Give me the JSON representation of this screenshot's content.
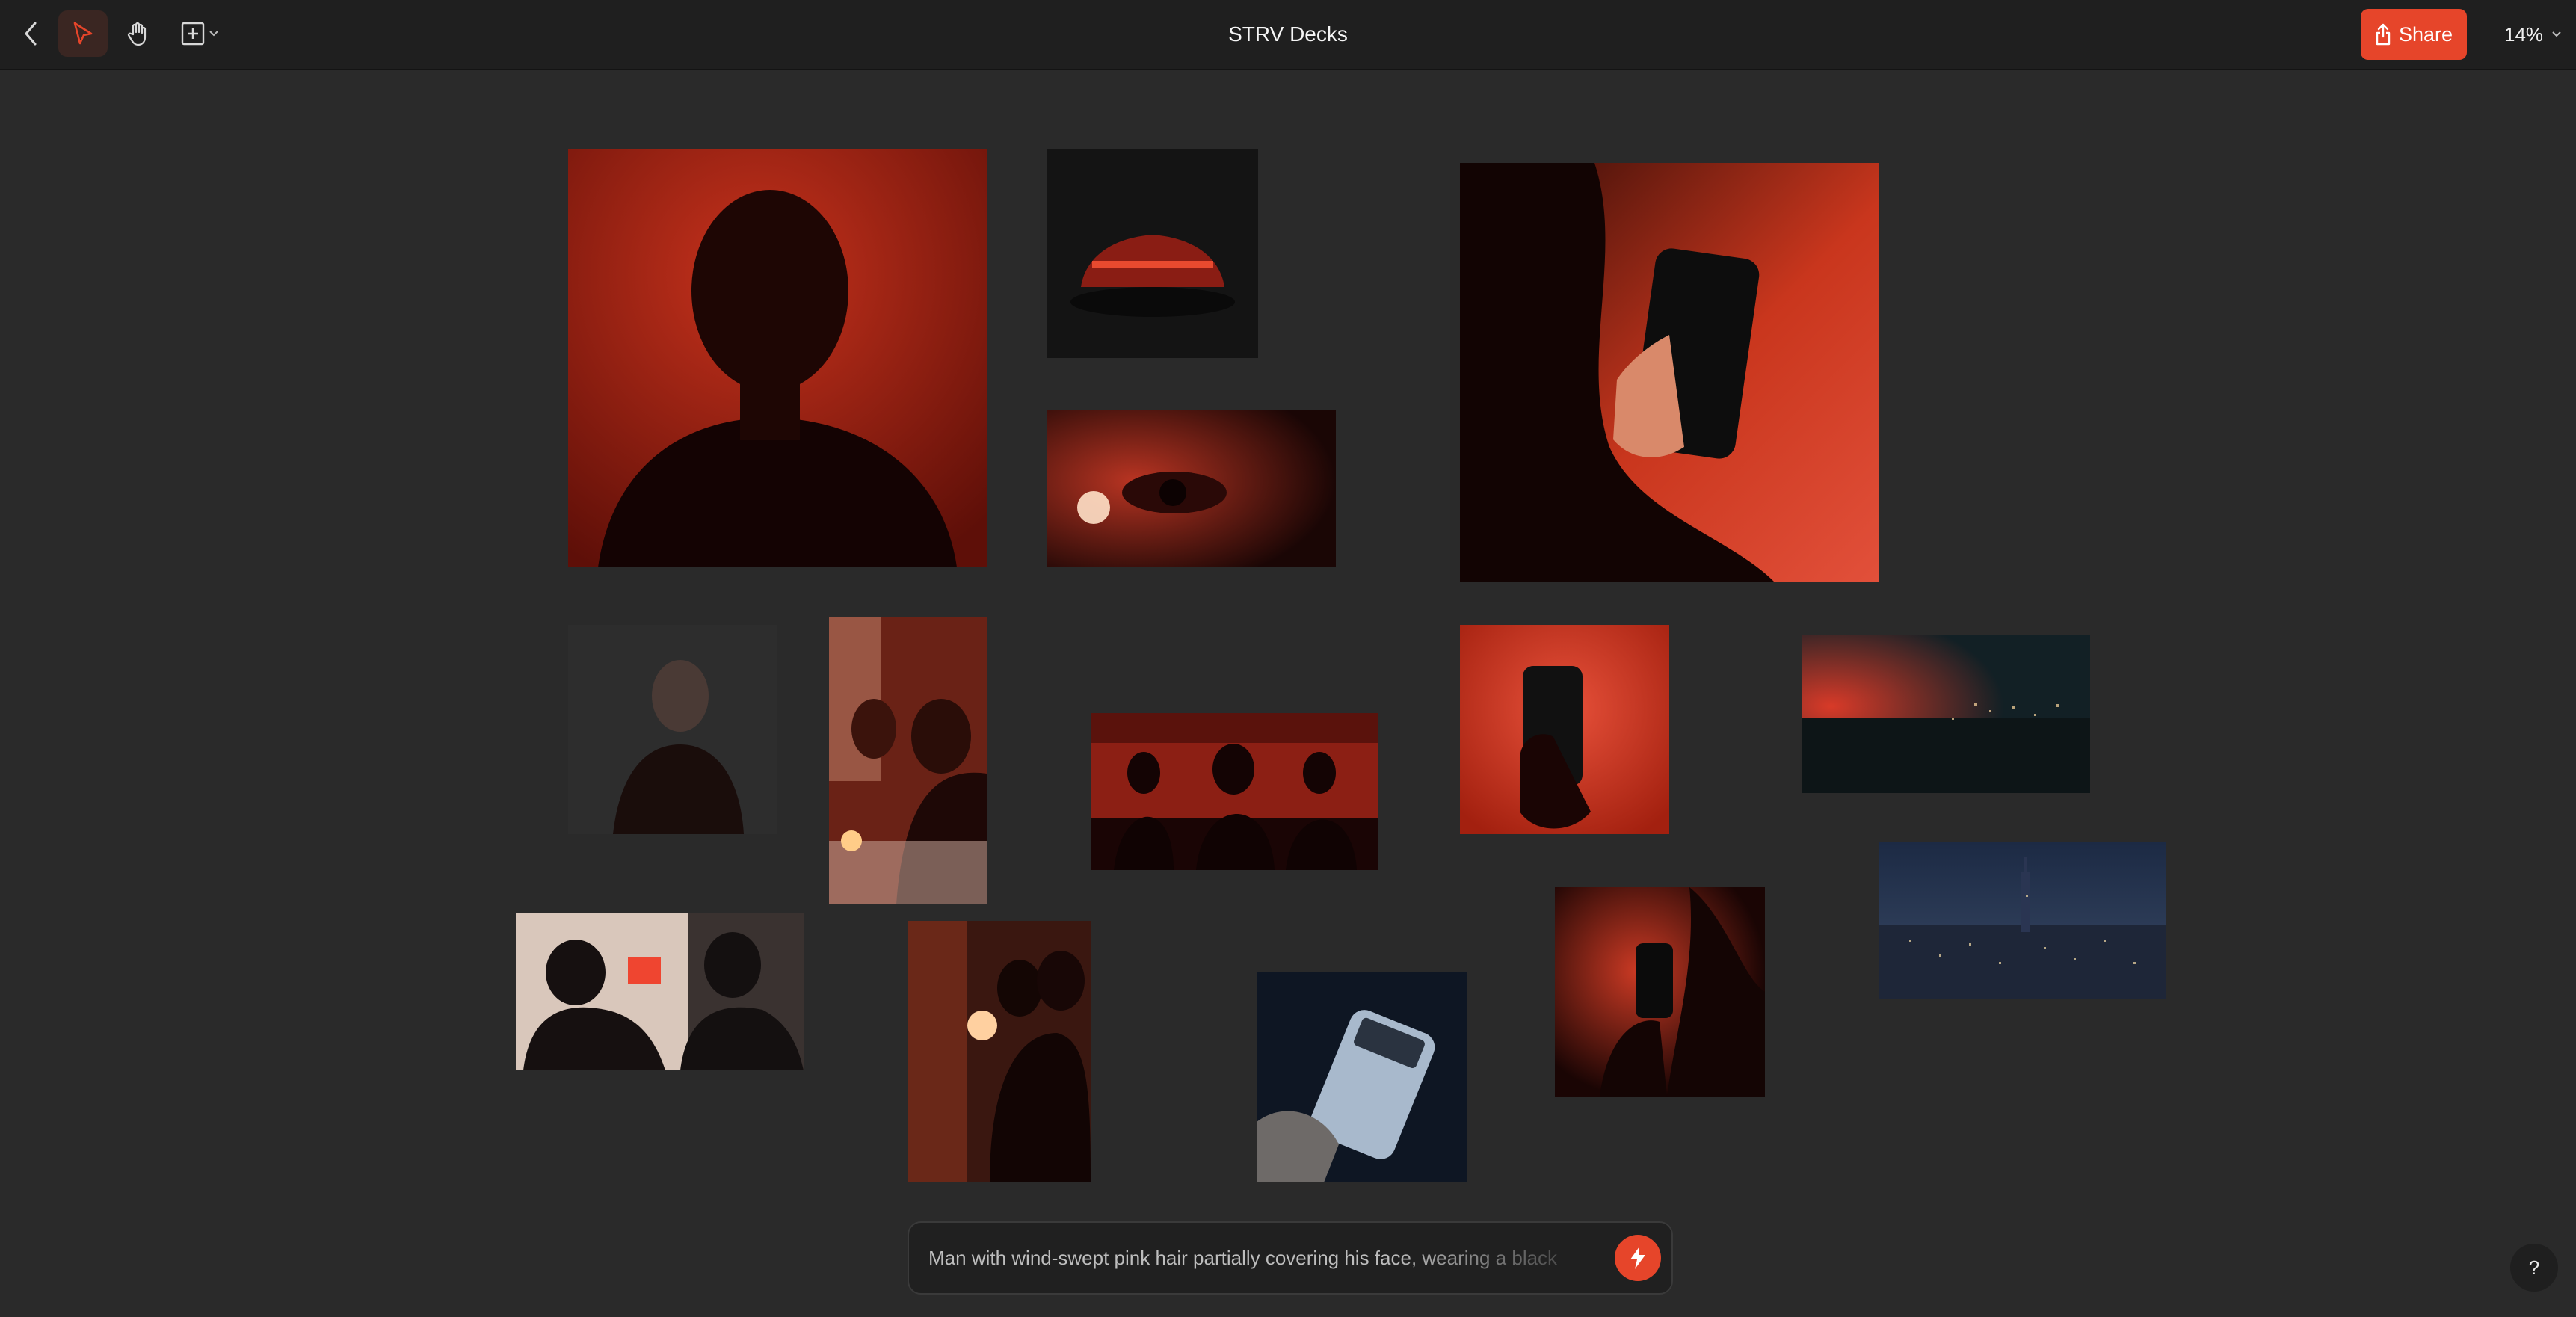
{
  "app": {
    "title": "STRV Decks",
    "share_label": "Share",
    "zoom_label": "14%"
  },
  "toolbar": {
    "back_icon": "chevron-left-icon",
    "select_icon": "cursor-arrow-icon",
    "hand_icon": "hand-icon",
    "frame_icon": "frame-plus-icon"
  },
  "colors": {
    "accent": "#e6452a",
    "canvas": "#2a2a2a",
    "topbar": "#1f1f1f"
  },
  "canvas_images": [
    {
      "subject": "portrait man red background"
    },
    {
      "subject": "red sports car rear"
    },
    {
      "subject": "phone held against red background"
    },
    {
      "subject": "eye close-up red light"
    },
    {
      "subject": "woman portrait dark"
    },
    {
      "subject": "team at table red office"
    },
    {
      "subject": "meeting silhouettes red room"
    },
    {
      "subject": "hand holding phone red"
    },
    {
      "subject": "city skyline red haze"
    },
    {
      "subject": "people at window with sticky note"
    },
    {
      "subject": "people writing on wall"
    },
    {
      "subject": "hand holding phone blue"
    },
    {
      "subject": "silhouette with phone red"
    },
    {
      "subject": "city skyline night"
    }
  ],
  "prompt": {
    "text": "Man with wind-swept pink hair partially covering his face, wearing a black",
    "send_icon": "lightning-icon"
  },
  "help": {
    "label": "?"
  }
}
